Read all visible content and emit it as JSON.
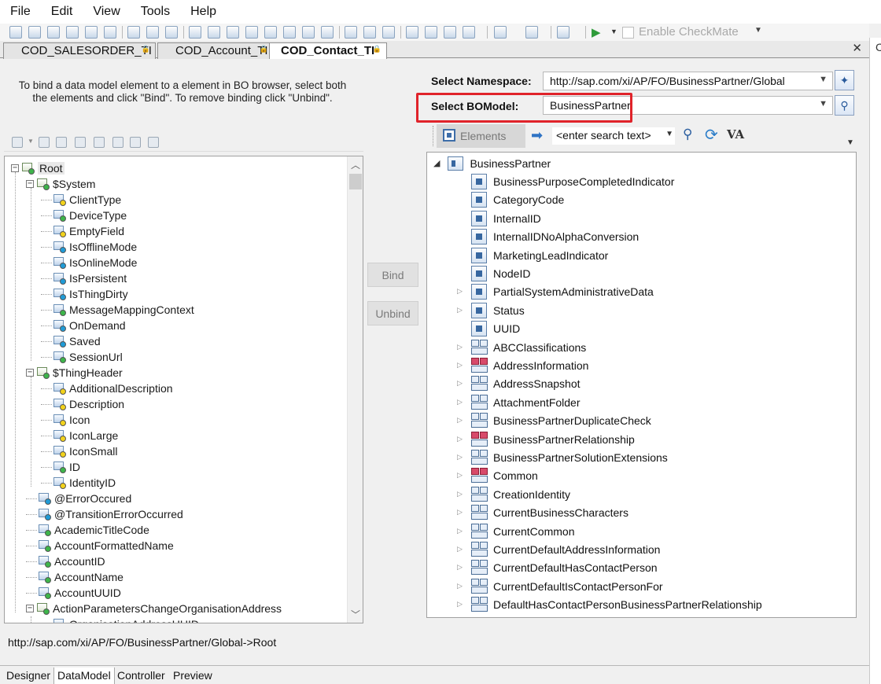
{
  "menu": [
    "File",
    "Edit",
    "View",
    "Tools",
    "Help"
  ],
  "toolbar": {
    "enable_checkmate_label": "Enable CheckMate"
  },
  "doc_tabs": [
    {
      "label": "COD_SALESORDER_TI",
      "active": false
    },
    {
      "label": "COD_Account_TI",
      "active": false
    },
    {
      "label": "COD_Contact_TI",
      "active": true
    }
  ],
  "close_symbol": "✕",
  "instructions": "To bind a data model element to a element in BO browser, select both the elements and click \"Bind\". To remove binding click \"Unbind\".",
  "bind_label": "Bind",
  "unbind_label": "Unbind",
  "namespace": {
    "label": "Select Namespace:",
    "value": "http://sap.com/xi/AP/FO/BusinessPartner/Global"
  },
  "bomodel": {
    "label": "Select BOModel:",
    "value": "BusinessPartner"
  },
  "elements_tab_label": "Elements",
  "search_placeholder": "<enter search text>",
  "va_label": "VA",
  "data_model_tree": [
    {
      "label": "Root",
      "level": 0,
      "expanded": true,
      "icon": "root-node-icon",
      "selected": true
    },
    {
      "label": "$System",
      "level": 1,
      "expanded": true,
      "icon": "structure-node-icon"
    },
    {
      "label": "ClientType",
      "level": 2,
      "icon": "element-icon",
      "dot": "yellow"
    },
    {
      "label": "DeviceType",
      "level": 2,
      "icon": "element-icon",
      "dot": "green"
    },
    {
      "label": "EmptyField",
      "level": 2,
      "icon": "element-icon",
      "dot": "yellow"
    },
    {
      "label": "IsOfflineMode",
      "level": 2,
      "icon": "element-icon",
      "dot": "blue"
    },
    {
      "label": "IsOnlineMode",
      "level": 2,
      "icon": "element-icon",
      "dot": "blue"
    },
    {
      "label": "IsPersistent",
      "level": 2,
      "icon": "element-icon",
      "dot": "blue"
    },
    {
      "label": "IsThingDirty",
      "level": 2,
      "icon": "element-icon",
      "dot": "blue"
    },
    {
      "label": "MessageMappingContext",
      "level": 2,
      "icon": "element-icon",
      "dot": "green"
    },
    {
      "label": "OnDemand",
      "level": 2,
      "icon": "element-icon",
      "dot": "blue"
    },
    {
      "label": "Saved",
      "level": 2,
      "icon": "element-icon",
      "dot": "blue"
    },
    {
      "label": "SessionUrl",
      "level": 2,
      "icon": "element-icon",
      "dot": "green"
    },
    {
      "label": "$ThingHeader",
      "level": 1,
      "expanded": true,
      "icon": "structure-node-icon"
    },
    {
      "label": "AdditionalDescription",
      "level": 2,
      "icon": "element-icon",
      "dot": "yellow"
    },
    {
      "label": "Description",
      "level": 2,
      "icon": "element-icon",
      "dot": "yellow"
    },
    {
      "label": "Icon",
      "level": 2,
      "icon": "element-icon",
      "dot": "yellow"
    },
    {
      "label": "IconLarge",
      "level": 2,
      "icon": "element-icon",
      "dot": "yellow"
    },
    {
      "label": "IconSmall",
      "level": 2,
      "icon": "element-icon",
      "dot": "yellow"
    },
    {
      "label": "ID",
      "level": 2,
      "icon": "element-icon",
      "dot": "green"
    },
    {
      "label": "IdentityID",
      "level": 2,
      "icon": "element-icon",
      "dot": "yellow"
    },
    {
      "label": "@ErrorOccured",
      "level": 1,
      "icon": "element-icon",
      "dot": "blue"
    },
    {
      "label": "@TransitionErrorOccurred",
      "level": 1,
      "icon": "element-icon",
      "dot": "blue"
    },
    {
      "label": "AcademicTitleCode",
      "level": 1,
      "icon": "element-icon",
      "dot": "green"
    },
    {
      "label": "AccountFormattedName",
      "level": 1,
      "icon": "element-icon",
      "dot": "green"
    },
    {
      "label": "AccountID",
      "level": 1,
      "icon": "element-icon",
      "dot": "green"
    },
    {
      "label": "AccountName",
      "level": 1,
      "icon": "element-icon",
      "dot": "green"
    },
    {
      "label": "AccountUUID",
      "level": 1,
      "icon": "element-icon",
      "dot": "green"
    },
    {
      "label": "ActionParametersChangeOrganisationAddress",
      "level": 1,
      "expanded": true,
      "icon": "structure-node-icon"
    },
    {
      "label": "OrganisationAddressUUID",
      "level": 2,
      "icon": "element-icon",
      "dot": "blue"
    }
  ],
  "bo_tree": {
    "root": "BusinessPartner",
    "children": [
      {
        "label": "BusinessPurposeCompletedIndicator",
        "kind": "element",
        "expandable": false
      },
      {
        "label": "CategoryCode",
        "kind": "element",
        "expandable": false
      },
      {
        "label": "InternalID",
        "kind": "element",
        "expandable": false
      },
      {
        "label": "InternalIDNoAlphaConversion",
        "kind": "element",
        "expandable": false
      },
      {
        "label": "MarketingLeadIndicator",
        "kind": "element",
        "expandable": false
      },
      {
        "label": "NodeID",
        "kind": "element",
        "expandable": false
      },
      {
        "label": "PartialSystemAdministrativeData",
        "kind": "element",
        "expandable": true
      },
      {
        "label": "Status",
        "kind": "element",
        "expandable": true
      },
      {
        "label": "UUID",
        "kind": "element",
        "expandable": false
      },
      {
        "label": "ABCClassifications",
        "kind": "association",
        "expandable": true
      },
      {
        "label": "AddressInformation",
        "kind": "association-red",
        "expandable": true
      },
      {
        "label": "AddressSnapshot",
        "kind": "association",
        "expandable": true
      },
      {
        "label": "AttachmentFolder",
        "kind": "association",
        "expandable": true
      },
      {
        "label": "BusinessPartnerDuplicateCheck",
        "kind": "association",
        "expandable": true
      },
      {
        "label": "BusinessPartnerRelationship",
        "kind": "association-red",
        "expandable": true
      },
      {
        "label": "BusinessPartnerSolutionExtensions",
        "kind": "association",
        "expandable": true
      },
      {
        "label": "Common",
        "kind": "association-red",
        "expandable": true
      },
      {
        "label": "CreationIdentity",
        "kind": "association",
        "expandable": true
      },
      {
        "label": "CurrentBusinessCharacters",
        "kind": "association",
        "expandable": true
      },
      {
        "label": "CurrentCommon",
        "kind": "association",
        "expandable": true
      },
      {
        "label": "CurrentDefaultAddressInformation",
        "kind": "association",
        "expandable": true
      },
      {
        "label": "CurrentDefaultHasContactPerson",
        "kind": "association",
        "expandable": true
      },
      {
        "label": "CurrentDefaultIsContactPersonFor",
        "kind": "association",
        "expandable": true
      },
      {
        "label": "DefaultHasContactPersonBusinessPartnerRelationship",
        "kind": "association",
        "expandable": true
      }
    ]
  },
  "status_path": "http://sap.com/xi/AP/FO/BusinessPartner/Global->Root",
  "bottom_tabs": [
    {
      "label": "Designer",
      "active": false
    },
    {
      "label": "DataModel",
      "active": true
    },
    {
      "label": "Controller",
      "active": false
    },
    {
      "label": "Preview",
      "active": false
    }
  ],
  "colors": {
    "highlight": "#e0232a",
    "dot_yellow": "#f2d21b",
    "dot_green": "#3db54a",
    "dot_blue": "#1f9bd7"
  }
}
